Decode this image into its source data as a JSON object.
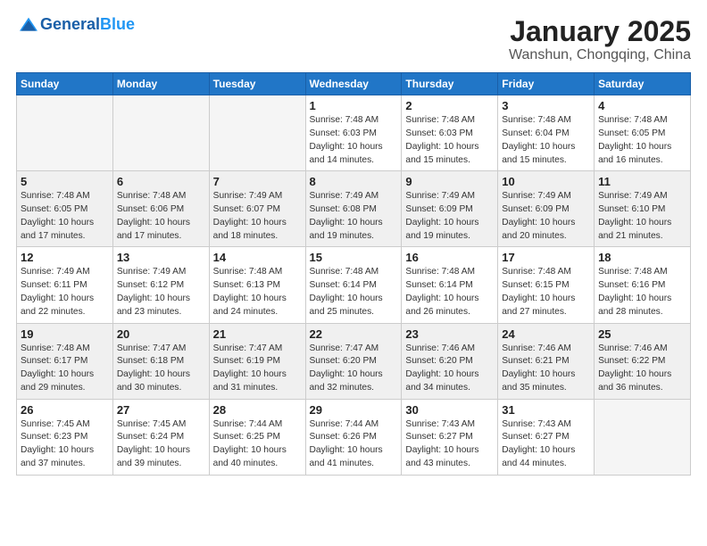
{
  "header": {
    "logo_general": "General",
    "logo_blue": "Blue",
    "title": "January 2025",
    "subtitle": "Wanshun, Chongqing, China"
  },
  "weekdays": [
    "Sunday",
    "Monday",
    "Tuesday",
    "Wednesday",
    "Thursday",
    "Friday",
    "Saturday"
  ],
  "weeks": [
    [
      {
        "day": "",
        "info": ""
      },
      {
        "day": "",
        "info": ""
      },
      {
        "day": "",
        "info": ""
      },
      {
        "day": "1",
        "info": "Sunrise: 7:48 AM\nSunset: 6:03 PM\nDaylight: 10 hours\nand 14 minutes."
      },
      {
        "day": "2",
        "info": "Sunrise: 7:48 AM\nSunset: 6:03 PM\nDaylight: 10 hours\nand 15 minutes."
      },
      {
        "day": "3",
        "info": "Sunrise: 7:48 AM\nSunset: 6:04 PM\nDaylight: 10 hours\nand 15 minutes."
      },
      {
        "day": "4",
        "info": "Sunrise: 7:48 AM\nSunset: 6:05 PM\nDaylight: 10 hours\nand 16 minutes."
      }
    ],
    [
      {
        "day": "5",
        "info": "Sunrise: 7:48 AM\nSunset: 6:05 PM\nDaylight: 10 hours\nand 17 minutes."
      },
      {
        "day": "6",
        "info": "Sunrise: 7:48 AM\nSunset: 6:06 PM\nDaylight: 10 hours\nand 17 minutes."
      },
      {
        "day": "7",
        "info": "Sunrise: 7:49 AM\nSunset: 6:07 PM\nDaylight: 10 hours\nand 18 minutes."
      },
      {
        "day": "8",
        "info": "Sunrise: 7:49 AM\nSunset: 6:08 PM\nDaylight: 10 hours\nand 19 minutes."
      },
      {
        "day": "9",
        "info": "Sunrise: 7:49 AM\nSunset: 6:09 PM\nDaylight: 10 hours\nand 19 minutes."
      },
      {
        "day": "10",
        "info": "Sunrise: 7:49 AM\nSunset: 6:09 PM\nDaylight: 10 hours\nand 20 minutes."
      },
      {
        "day": "11",
        "info": "Sunrise: 7:49 AM\nSunset: 6:10 PM\nDaylight: 10 hours\nand 21 minutes."
      }
    ],
    [
      {
        "day": "12",
        "info": "Sunrise: 7:49 AM\nSunset: 6:11 PM\nDaylight: 10 hours\nand 22 minutes."
      },
      {
        "day": "13",
        "info": "Sunrise: 7:49 AM\nSunset: 6:12 PM\nDaylight: 10 hours\nand 23 minutes."
      },
      {
        "day": "14",
        "info": "Sunrise: 7:48 AM\nSunset: 6:13 PM\nDaylight: 10 hours\nand 24 minutes."
      },
      {
        "day": "15",
        "info": "Sunrise: 7:48 AM\nSunset: 6:14 PM\nDaylight: 10 hours\nand 25 minutes."
      },
      {
        "day": "16",
        "info": "Sunrise: 7:48 AM\nSunset: 6:14 PM\nDaylight: 10 hours\nand 26 minutes."
      },
      {
        "day": "17",
        "info": "Sunrise: 7:48 AM\nSunset: 6:15 PM\nDaylight: 10 hours\nand 27 minutes."
      },
      {
        "day": "18",
        "info": "Sunrise: 7:48 AM\nSunset: 6:16 PM\nDaylight: 10 hours\nand 28 minutes."
      }
    ],
    [
      {
        "day": "19",
        "info": "Sunrise: 7:48 AM\nSunset: 6:17 PM\nDaylight: 10 hours\nand 29 minutes."
      },
      {
        "day": "20",
        "info": "Sunrise: 7:47 AM\nSunset: 6:18 PM\nDaylight: 10 hours\nand 30 minutes."
      },
      {
        "day": "21",
        "info": "Sunrise: 7:47 AM\nSunset: 6:19 PM\nDaylight: 10 hours\nand 31 minutes."
      },
      {
        "day": "22",
        "info": "Sunrise: 7:47 AM\nSunset: 6:20 PM\nDaylight: 10 hours\nand 32 minutes."
      },
      {
        "day": "23",
        "info": "Sunrise: 7:46 AM\nSunset: 6:20 PM\nDaylight: 10 hours\nand 34 minutes."
      },
      {
        "day": "24",
        "info": "Sunrise: 7:46 AM\nSunset: 6:21 PM\nDaylight: 10 hours\nand 35 minutes."
      },
      {
        "day": "25",
        "info": "Sunrise: 7:46 AM\nSunset: 6:22 PM\nDaylight: 10 hours\nand 36 minutes."
      }
    ],
    [
      {
        "day": "26",
        "info": "Sunrise: 7:45 AM\nSunset: 6:23 PM\nDaylight: 10 hours\nand 37 minutes."
      },
      {
        "day": "27",
        "info": "Sunrise: 7:45 AM\nSunset: 6:24 PM\nDaylight: 10 hours\nand 39 minutes."
      },
      {
        "day": "28",
        "info": "Sunrise: 7:44 AM\nSunset: 6:25 PM\nDaylight: 10 hours\nand 40 minutes."
      },
      {
        "day": "29",
        "info": "Sunrise: 7:44 AM\nSunset: 6:26 PM\nDaylight: 10 hours\nand 41 minutes."
      },
      {
        "day": "30",
        "info": "Sunrise: 7:43 AM\nSunset: 6:27 PM\nDaylight: 10 hours\nand 43 minutes."
      },
      {
        "day": "31",
        "info": "Sunrise: 7:43 AM\nSunset: 6:27 PM\nDaylight: 10 hours\nand 44 minutes."
      },
      {
        "day": "",
        "info": ""
      }
    ]
  ]
}
